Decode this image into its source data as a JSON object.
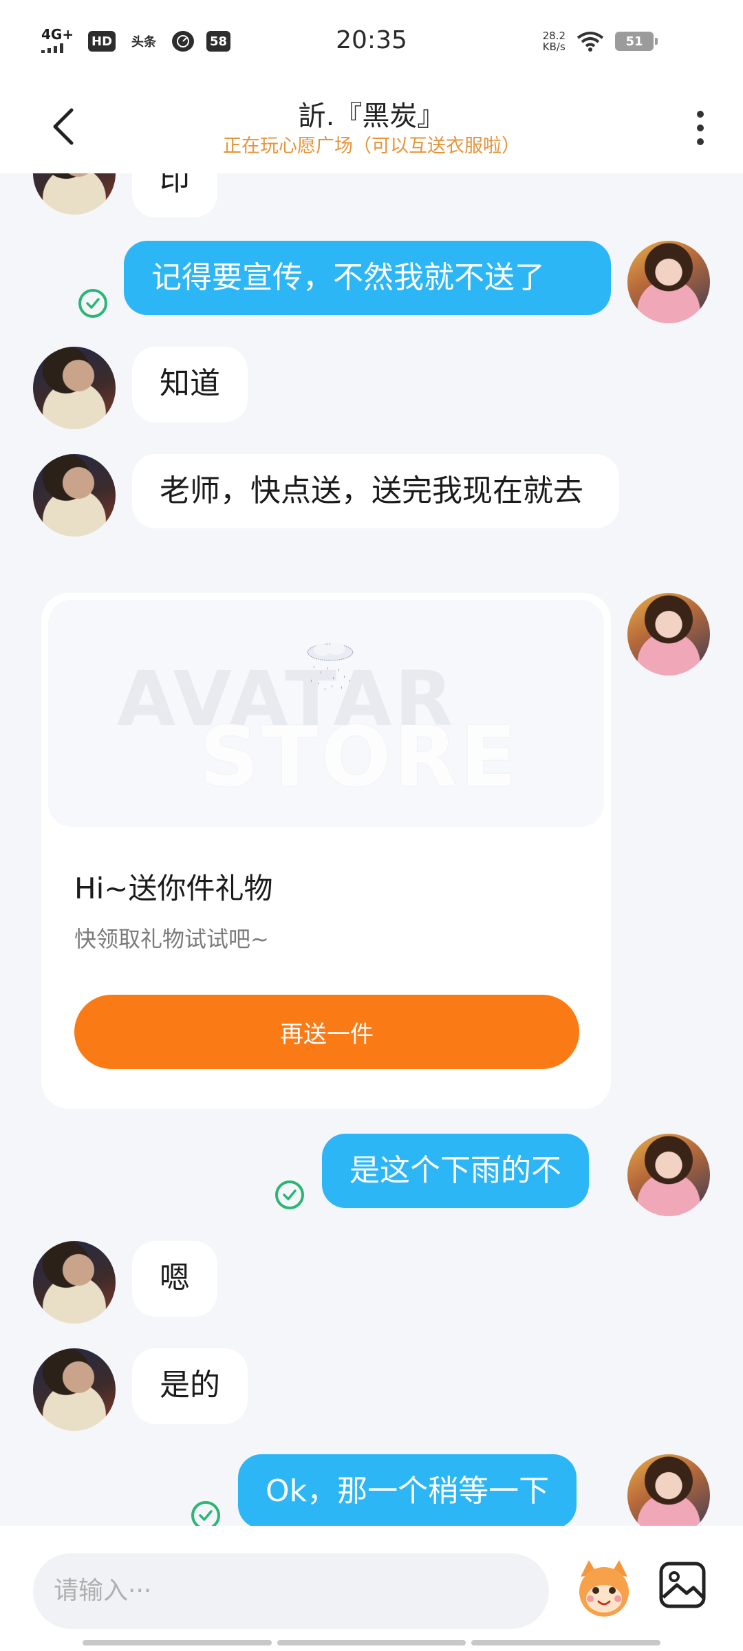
{
  "status_bar": {
    "network": "4G+",
    "hd": "HD",
    "app_badge": "头条",
    "badge_count": "58",
    "time": "20:35",
    "speed_value": "28.2",
    "speed_unit": "KB/s",
    "battery": "51"
  },
  "header": {
    "title": "訢.『黑炭』",
    "subtitle": "正在玩心愿广场（可以互送衣服啦）"
  },
  "messages": {
    "m0": "印",
    "m1": "记得要宣传，不然我就不送了",
    "m2": "知道",
    "m3": "老师，快点送，送完我现在就去",
    "m5": "是这个下雨的不",
    "m6": "嗯",
    "m7": "是的",
    "m8": "Ok，那一个稍等一下"
  },
  "gift_card": {
    "watermark_line1": "AVATAR",
    "watermark_line2": "STORE",
    "title": "Hi~送你件礼物",
    "subtitle": "快领取礼物试试吧~",
    "button_label": "再送一件"
  },
  "input": {
    "placeholder": "请输入···"
  },
  "colors": {
    "outgoing_bubble": "#2db6f5",
    "incoming_bubble": "#ffffff",
    "accent_orange": "#fa7a16",
    "subtitle_orange": "#e6943a",
    "read_check": "#2bb673"
  }
}
